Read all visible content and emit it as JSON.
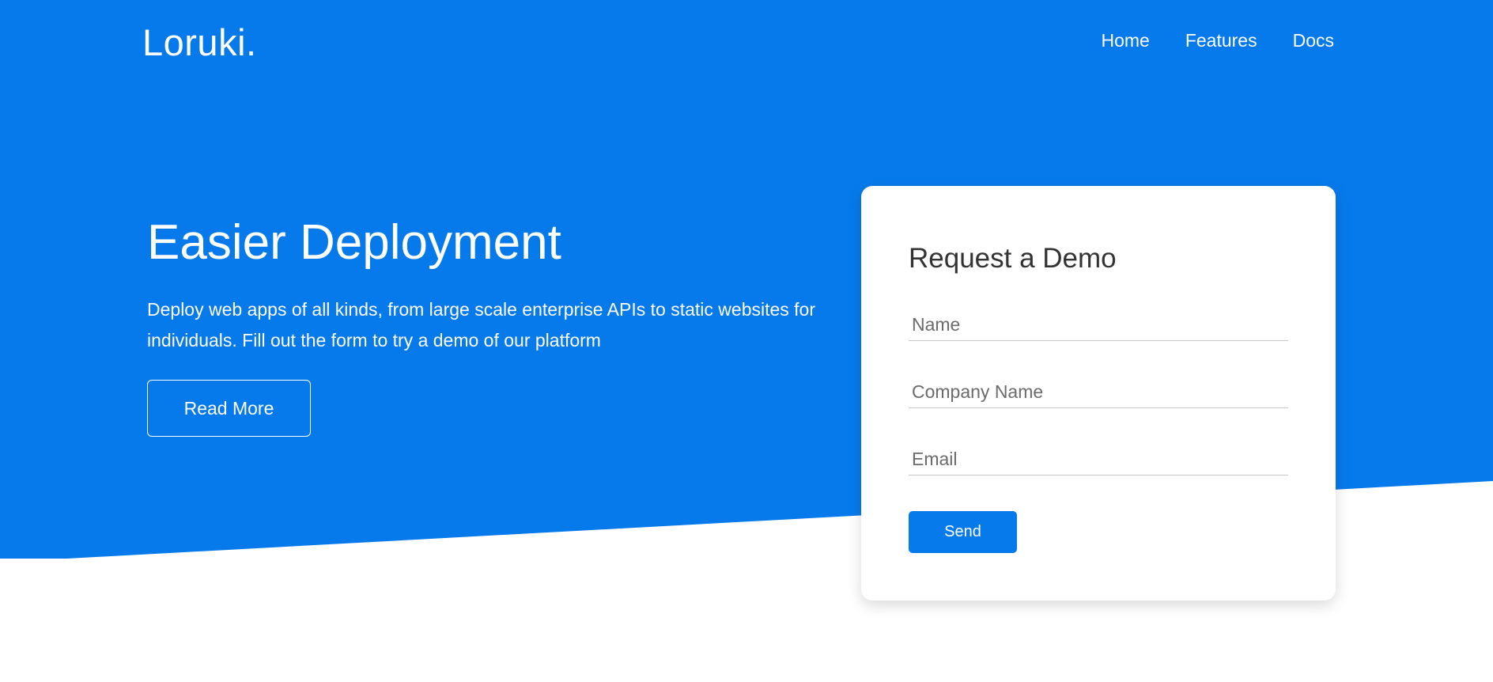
{
  "colors": {
    "hero_blue": "#077aeb",
    "white": "#ffffff",
    "card_title": "#333333",
    "placeholder": "#6b6b6b"
  },
  "header": {
    "logo": "Loruki.",
    "nav": [
      "Home",
      "Features",
      "Docs"
    ]
  },
  "hero": {
    "headline": "Easier Deployment",
    "subtext": "Deploy web apps of all kinds, from large scale enterprise APIs to static websites for individuals. Fill out the form to try a demo of our platform",
    "read_more_label": "Read More"
  },
  "form": {
    "title": "Request a Demo",
    "name_placeholder": "Name",
    "company_placeholder": "Company Name",
    "email_placeholder": "Email",
    "send_label": "Send"
  }
}
